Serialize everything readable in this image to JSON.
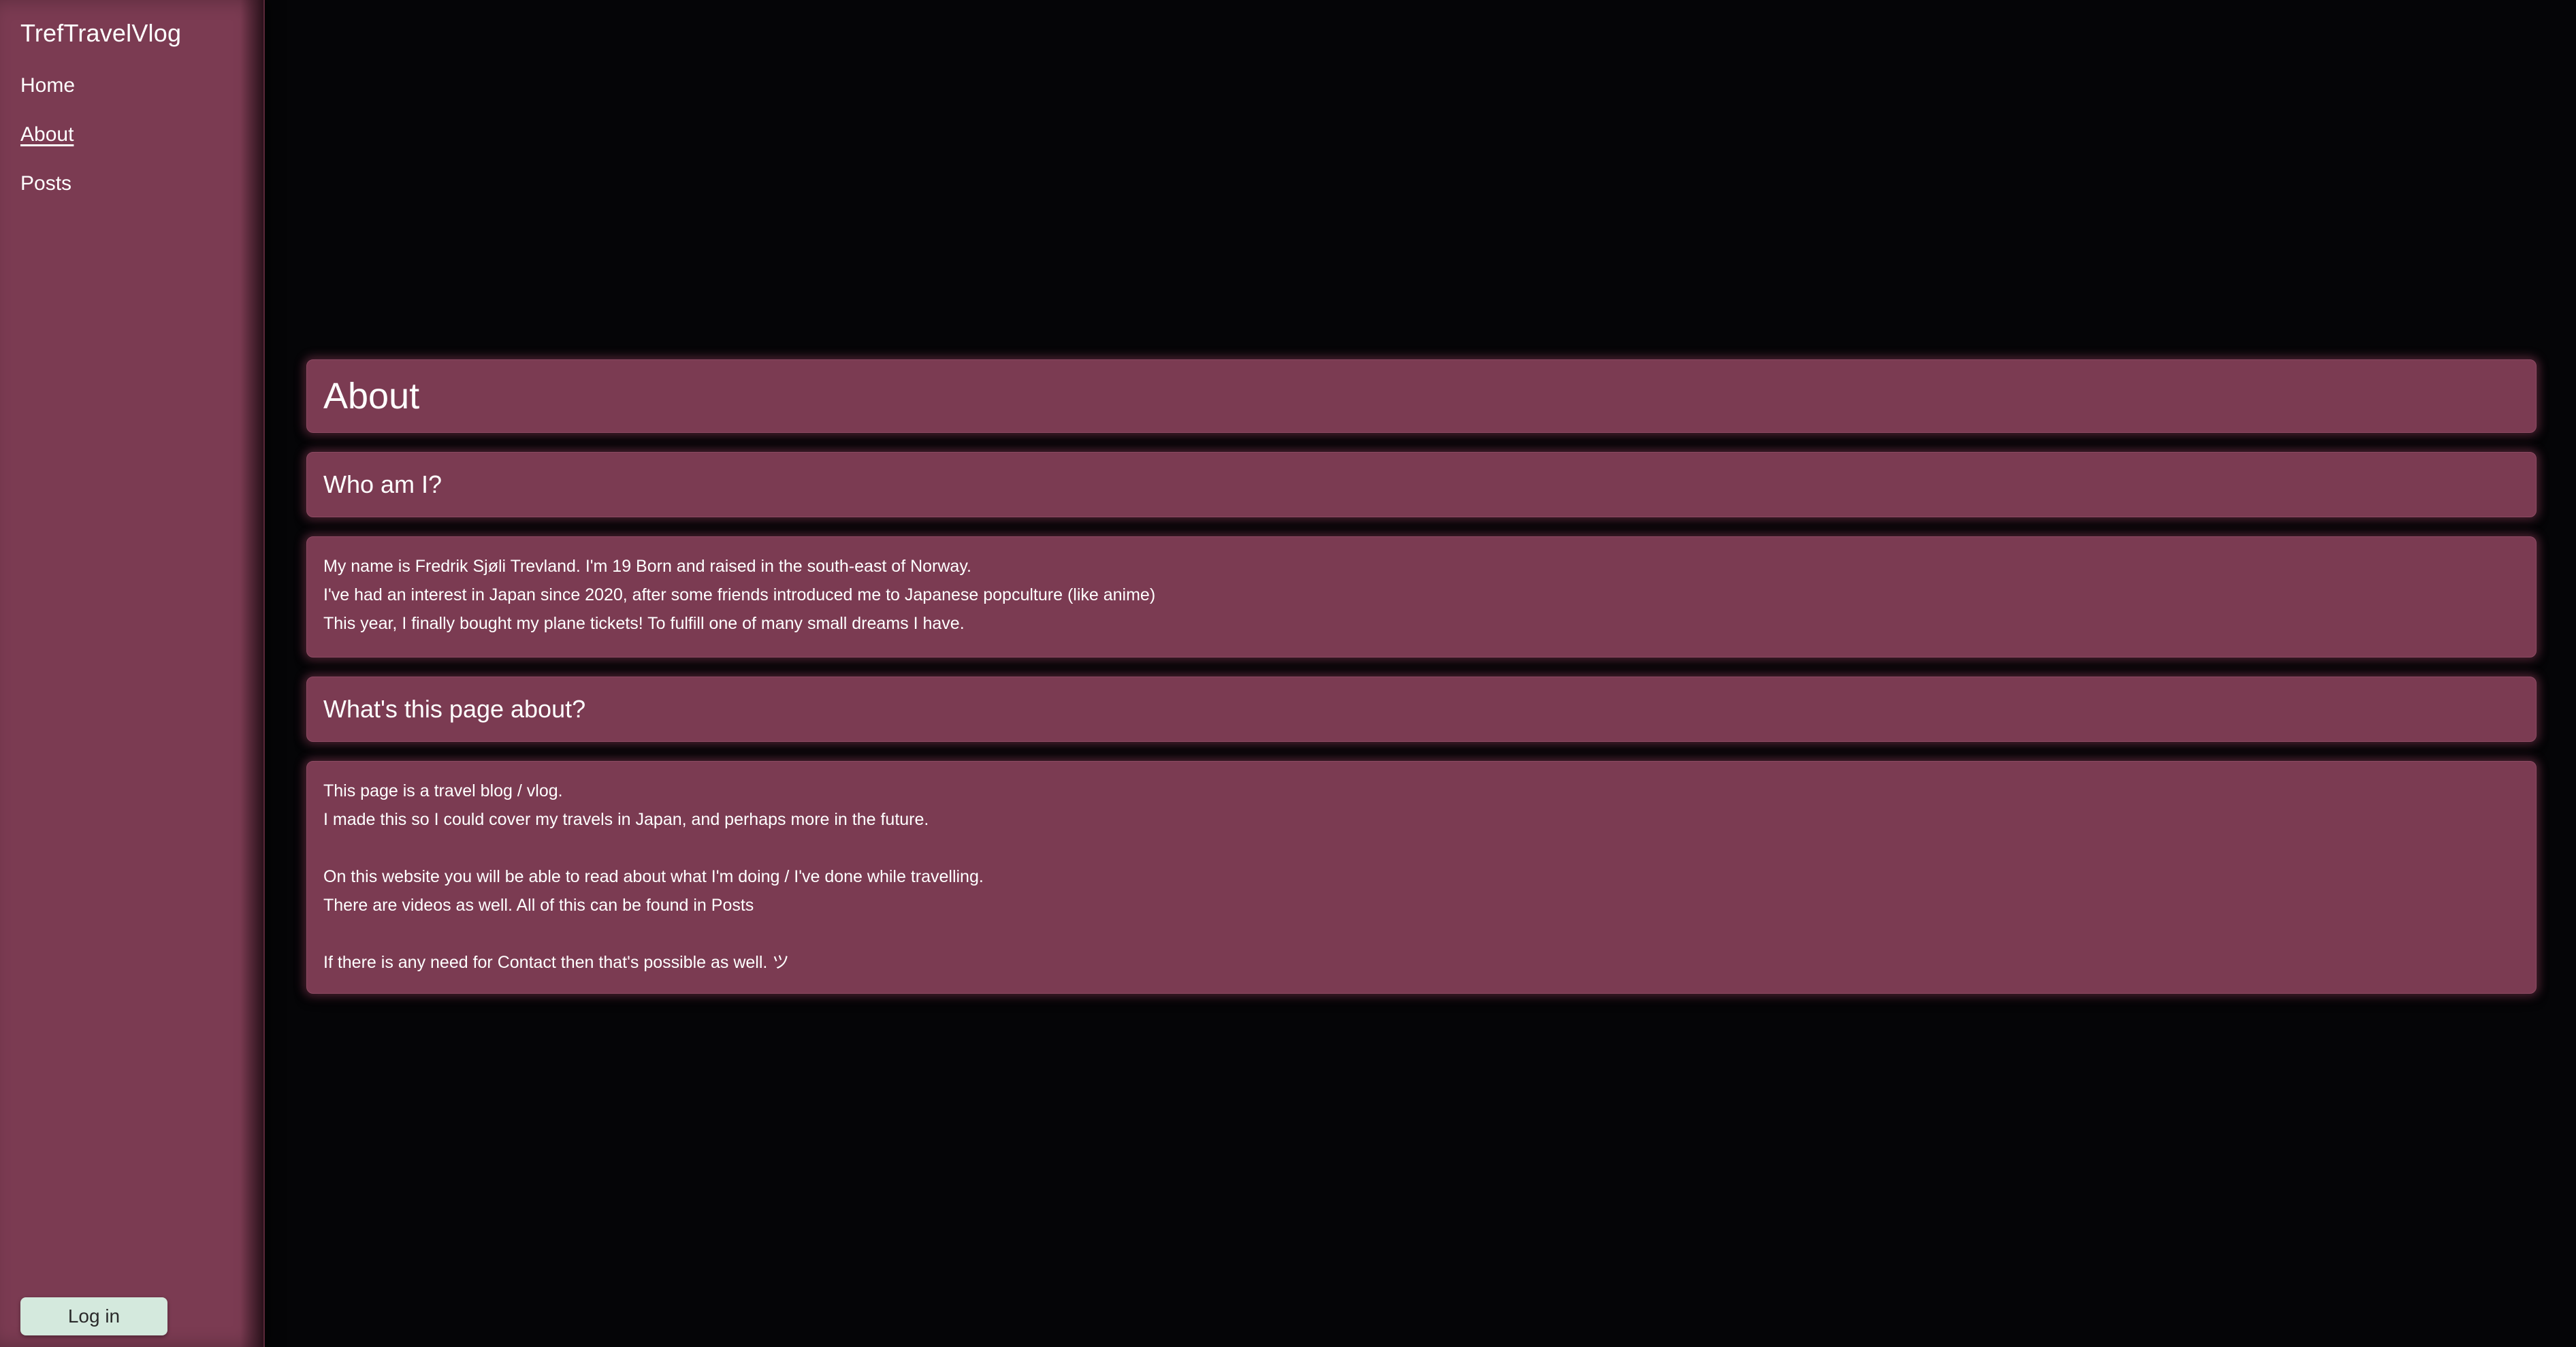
{
  "sidebar": {
    "brand": "TrefTravelVlog",
    "nav": [
      {
        "label": "Home",
        "active": false
      },
      {
        "label": "About",
        "active": true
      },
      {
        "label": "Posts",
        "active": false
      }
    ],
    "login_label": "Log in"
  },
  "main": {
    "title": "About",
    "sections": [
      {
        "heading": "Who am I?",
        "lines": [
          "My name is Fredrik Sjøli Trevland. I'm 19 Born and raised in the south-east of Norway.",
          "I've had an interest in Japan since 2020, after some friends introduced me to Japanese popculture (like anime)",
          "This year, I finally bought my plane tickets! To fulfill one of many small dreams I have."
        ]
      },
      {
        "heading": "What's this page about?",
        "lines": [
          "This page is a travel blog / vlog.",
          "I made this so I could cover my travels in Japan, and perhaps more in the future.",
          "",
          "On this website you will be able to read about what I'm doing / I've done while travelling.",
          "There are videos as well. All of this can be found in Posts",
          "",
          "If there is any need for Contact then that's possible as well. ツ"
        ]
      }
    ]
  },
  "colors": {
    "background": "#050507",
    "panel": "#7b3b52",
    "sidebar": "#7b3b52",
    "login_button": "#d4e9dd",
    "text": "#ffffff"
  }
}
